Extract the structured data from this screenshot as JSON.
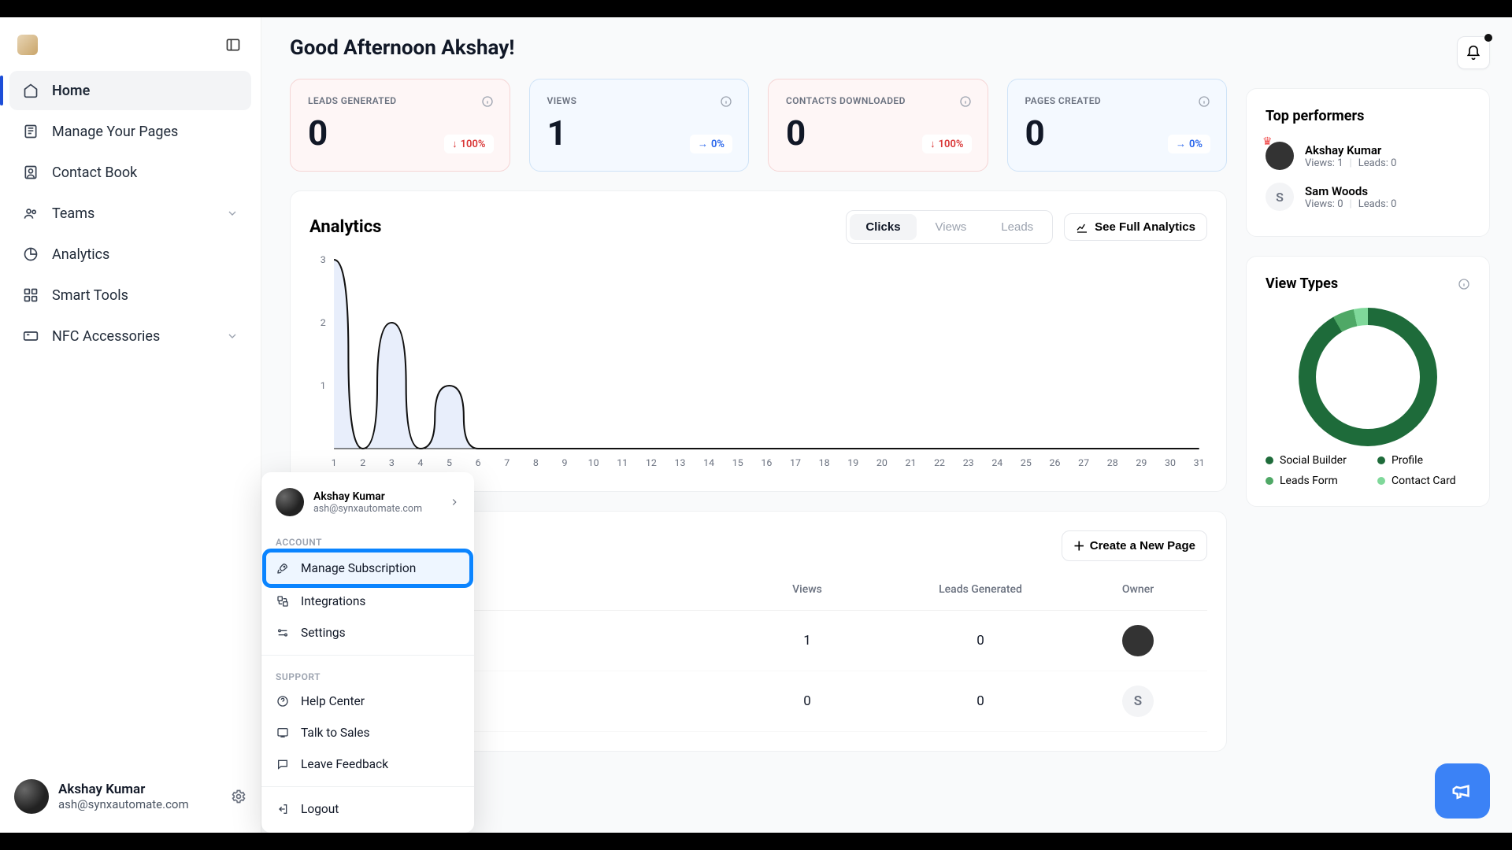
{
  "sidebar": {
    "items": [
      {
        "label": "Home",
        "icon": "home-icon",
        "active": true
      },
      {
        "label": "Manage Your Pages",
        "icon": "pages-icon"
      },
      {
        "label": "Contact Book",
        "icon": "contact-icon"
      },
      {
        "label": "Teams",
        "icon": "teams-icon",
        "expandable": true
      },
      {
        "label": "Analytics",
        "icon": "analytics-icon"
      },
      {
        "label": "Smart Tools",
        "icon": "tools-icon"
      },
      {
        "label": "NFC Accessories",
        "icon": "nfc-icon",
        "expandable": true
      }
    ]
  },
  "user": {
    "name": "Akshay Kumar",
    "email": "ash@synxautomate.com"
  },
  "popup": {
    "section_account": "ACCOUNT",
    "section_support": "SUPPORT",
    "items_account": [
      {
        "label": "Manage Subscription",
        "icon": "rocket-icon",
        "highlight": true
      },
      {
        "label": "Integrations",
        "icon": "integrations-icon"
      },
      {
        "label": "Settings",
        "icon": "settings-icon"
      }
    ],
    "items_support": [
      {
        "label": "Help Center",
        "icon": "help-icon"
      },
      {
        "label": "Talk to Sales",
        "icon": "sales-icon"
      },
      {
        "label": "Leave Feedback",
        "icon": "feedback-icon"
      }
    ],
    "logout": "Logout"
  },
  "header": {
    "greeting": "Good Afternoon Akshay!"
  },
  "stats": [
    {
      "title": "LEADS GENERATED",
      "value": "0",
      "delta": "100%",
      "dir": "down",
      "tone": "red"
    },
    {
      "title": "VIEWS",
      "value": "1",
      "delta": "0%",
      "dir": "neutral",
      "tone": "blue"
    },
    {
      "title": "CONTACTS DOWNLOADED",
      "value": "0",
      "delta": "100%",
      "dir": "down",
      "tone": "red"
    },
    {
      "title": "PAGES CREATED",
      "value": "0",
      "delta": "0%",
      "dir": "neutral",
      "tone": "blue"
    }
  ],
  "analytics": {
    "title": "Analytics",
    "tabs": [
      "Clicks",
      "Views",
      "Leads"
    ],
    "active_tab": "Clicks",
    "see_full": "See Full Analytics"
  },
  "chart_data": {
    "type": "line",
    "xlabel": "",
    "ylabel": "",
    "ylim": [
      0,
      3
    ],
    "yticks": [
      1,
      2,
      3
    ],
    "categories": [
      "1",
      "2",
      "3",
      "4",
      "5",
      "6",
      "7",
      "8",
      "9",
      "10",
      "11",
      "12",
      "13",
      "14",
      "15",
      "16",
      "17",
      "18",
      "19",
      "20",
      "21",
      "22",
      "23",
      "24",
      "25",
      "26",
      "27",
      "28",
      "29",
      "30",
      "31"
    ],
    "values": [
      3,
      0,
      2,
      0,
      1,
      0,
      0,
      0,
      0,
      0,
      0,
      0,
      0,
      0,
      0,
      0,
      0,
      0,
      0,
      0,
      0,
      0,
      0,
      0,
      0,
      0,
      0,
      0,
      0,
      0,
      0
    ]
  },
  "pages": {
    "columns": {
      "views": "Views",
      "leads": "Leads Generated",
      "owner": "Owner"
    },
    "create_label": "Create a New Page",
    "rows": [
      {
        "views": "1",
        "leads": "0",
        "owner_type": "avatar"
      },
      {
        "views": "0",
        "leads": "0",
        "owner_type": "letter",
        "owner_letter": "S"
      }
    ]
  },
  "top_performers": {
    "title": "Top performers",
    "items": [
      {
        "name": "Akshay Kumar",
        "views_label": "Views:",
        "views": "1",
        "leads_label": "Leads:",
        "leads": "0",
        "crown": true,
        "avatar": "image"
      },
      {
        "name": "Sam Woods",
        "views_label": "Views:",
        "views": "0",
        "leads_label": "Leads:",
        "leads": "0",
        "avatar": "letter",
        "letter": "S"
      }
    ]
  },
  "view_types": {
    "title": "View Types",
    "legend": [
      {
        "label": "Social Builder",
        "color": "#1e6b3a"
      },
      {
        "label": "Profile",
        "color": "#1e6b3a"
      },
      {
        "label": "Leads Form",
        "color": "#4fa866"
      },
      {
        "label": "Contact Card",
        "color": "#7fd89a"
      }
    ]
  }
}
